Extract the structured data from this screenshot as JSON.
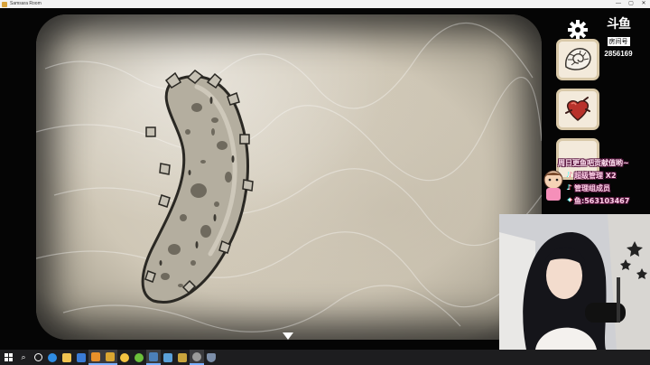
{
  "window": {
    "title": "Samsara Room",
    "controls": {
      "minimize": "—",
      "maximize": "▢",
      "close": "✕"
    }
  },
  "hud": {
    "logo_mark": "斗鱼",
    "logo_sub": "房间号",
    "room_number": "2856169"
  },
  "inventory": [
    {
      "item": "nautilus-shell",
      "icon": "nautilus-shell-icon"
    },
    {
      "item": "heart",
      "icon": "heart-icon"
    },
    {
      "item": "empty",
      "icon": ""
    }
  ],
  "danmu": {
    "line1": "周日更鱼吧贡献值哟~",
    "line2": "超级管理 X2",
    "line3": "管理组成员",
    "line4": "鱼:563103467"
  },
  "scene": {
    "object": "sea-cucumber"
  },
  "taskbar": {
    "items": [
      {
        "name": "start-button",
        "color": "#ffffff"
      },
      {
        "name": "search-icon",
        "color": "#ffffff"
      },
      {
        "name": "task-view-icon",
        "color": "#ffffff"
      },
      {
        "name": "edge-icon",
        "color": "#2f8de4"
      },
      {
        "name": "explorer-icon",
        "color": "#f0c350"
      },
      {
        "name": "store-icon",
        "color": "#3a7bd5"
      },
      {
        "name": "app-orange-icon",
        "color": "#e8902a"
      },
      {
        "name": "app-g-icon",
        "color": "#d9a531"
      },
      {
        "name": "app-o-icon",
        "color": "#f3c341"
      },
      {
        "name": "app-green-icon",
        "color": "#6bbf3b"
      },
      {
        "name": "steam-icon",
        "color": "#4b7fb8"
      },
      {
        "name": "app-bird-icon",
        "color": "#5aa0d8"
      },
      {
        "name": "app-l-icon",
        "color": "#c9a43c"
      },
      {
        "name": "obs-icon",
        "color": "#9a9a9a"
      },
      {
        "name": "shield-icon",
        "color": "#7c8ea8"
      }
    ]
  }
}
